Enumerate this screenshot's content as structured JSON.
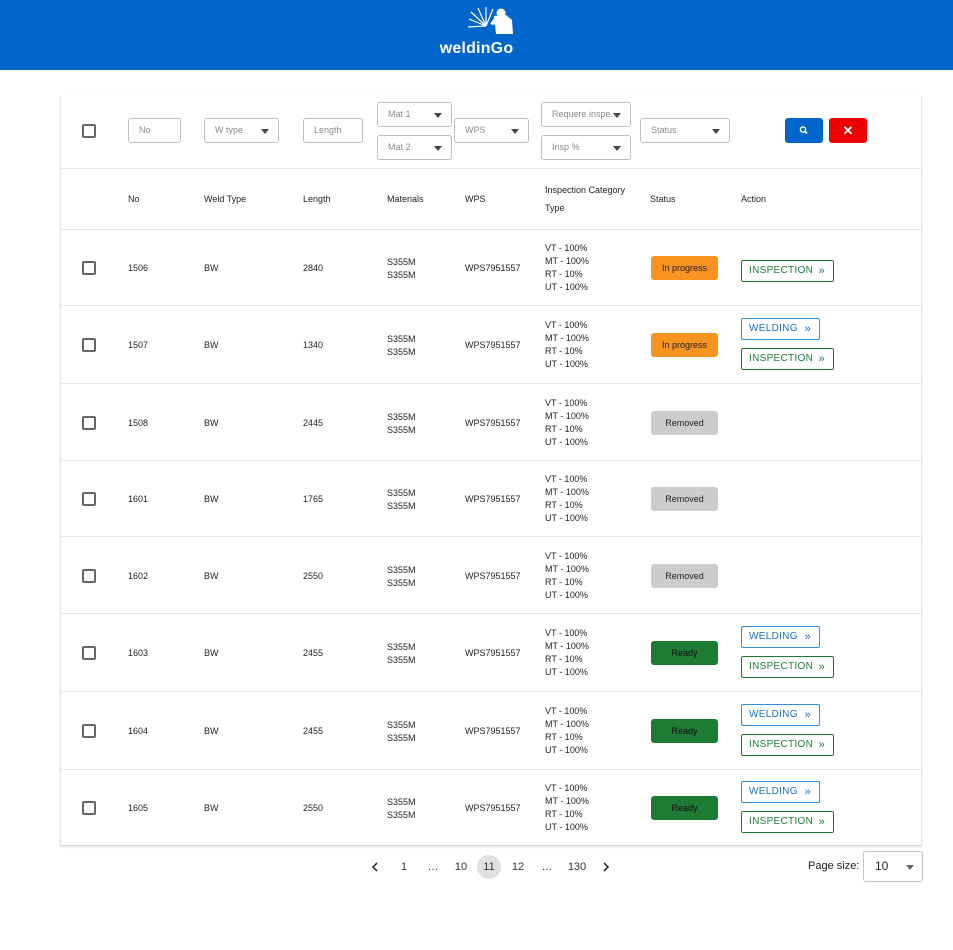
{
  "app": {
    "brand": "weldinGo"
  },
  "filters": {
    "no": "No",
    "w_type": "W type",
    "length": "Length",
    "mat1": "Mat 1",
    "mat2": "Mat 2",
    "wps": "WPS",
    "require_insp": "Requere inspe...",
    "insp_pct": "Insp %",
    "status": "Status",
    "clear_label": "✕"
  },
  "columns": {
    "no": "No",
    "weld_type": "Weld Type",
    "length": "Length",
    "materials": "Materials",
    "wps": "WPS",
    "inspection_line1": "Inspection Category",
    "inspection_line2": "Type",
    "status": "Status",
    "action": "Action"
  },
  "rows": [
    {
      "no": "1506",
      "weld_type": "BW",
      "length": "2840",
      "mat1": "S355M",
      "mat2": "S355M",
      "wps": "WPS7951557",
      "insp": [
        "VT - 100%",
        "MT - 100%",
        "RT - 10%",
        "UT - 100%"
      ],
      "status": "In progress",
      "status_kind": "inprogress",
      "actions": [
        "INSPECTION"
      ]
    },
    {
      "no": "1507",
      "weld_type": "BW",
      "length": "1340",
      "mat1": "S355M",
      "mat2": "S355M",
      "wps": "WPS7951557",
      "insp": [
        "VT - 100%",
        "MT - 100%",
        "RT - 10%",
        "UT - 100%"
      ],
      "status": "In progress",
      "status_kind": "inprogress",
      "actions": [
        "WELDING",
        "INSPECTION"
      ]
    },
    {
      "no": "1508",
      "weld_type": "BW",
      "length": "2445",
      "mat1": "S355M",
      "mat2": "S355M",
      "wps": "WPS7951557",
      "insp": [
        "VT - 100%",
        "MT - 100%",
        "RT - 10%",
        "UT - 100%"
      ],
      "status": "Removed",
      "status_kind": "removed",
      "actions": []
    },
    {
      "no": "1601",
      "weld_type": "BW",
      "length": "1765",
      "mat1": "S355M",
      "mat2": "S355M",
      "wps": "WPS7951557",
      "insp": [
        "VT - 100%",
        "MT - 100%",
        "RT - 10%",
        "UT - 100%"
      ],
      "status": "Removed",
      "status_kind": "removed",
      "actions": []
    },
    {
      "no": "1602",
      "weld_type": "BW",
      "length": "2550",
      "mat1": "S355M",
      "mat2": "S355M",
      "wps": "WPS7951557",
      "insp": [
        "VT - 100%",
        "MT - 100%",
        "RT - 10%",
        "UT - 100%"
      ],
      "status": "Removed",
      "status_kind": "removed",
      "actions": []
    },
    {
      "no": "1603",
      "weld_type": "BW",
      "length": "2455",
      "mat1": "S355M",
      "mat2": "S355M",
      "wps": "WPS7951557",
      "insp": [
        "VT - 100%",
        "MT - 100%",
        "RT - 10%",
        "UT - 100%"
      ],
      "status": "Ready",
      "status_kind": "ready",
      "actions": [
        "WELDING",
        "INSPECTION"
      ]
    },
    {
      "no": "1604",
      "weld_type": "BW",
      "length": "2455",
      "mat1": "S355M",
      "mat2": "S355M",
      "wps": "WPS7951557",
      "insp": [
        "VT - 100%",
        "MT - 100%",
        "RT - 10%",
        "UT - 100%"
      ],
      "status": "Ready",
      "status_kind": "ready",
      "actions": [
        "WELDING",
        "INSPECTION"
      ]
    },
    {
      "no": "1605",
      "weld_type": "BW",
      "length": "2550",
      "mat1": "S355M",
      "mat2": "S355M",
      "wps": "WPS7951557",
      "insp": [
        "VT - 100%",
        "MT - 100%",
        "RT - 10%",
        "UT - 100%"
      ],
      "status": "Ready",
      "status_kind": "ready",
      "actions": [
        "WELDING",
        "INSPECTION"
      ]
    }
  ],
  "pagination": {
    "pages": [
      "1",
      "…",
      "10",
      "11",
      "12",
      "…",
      "130"
    ],
    "current": "11",
    "page_size_label": "Page size:",
    "page_size": "10"
  },
  "colors": {
    "brand_blue": "#0066cc",
    "in_progress": "#f7931e",
    "removed": "#cccccc",
    "ready": "#1e7b34",
    "clear_red": "#ee0000"
  }
}
